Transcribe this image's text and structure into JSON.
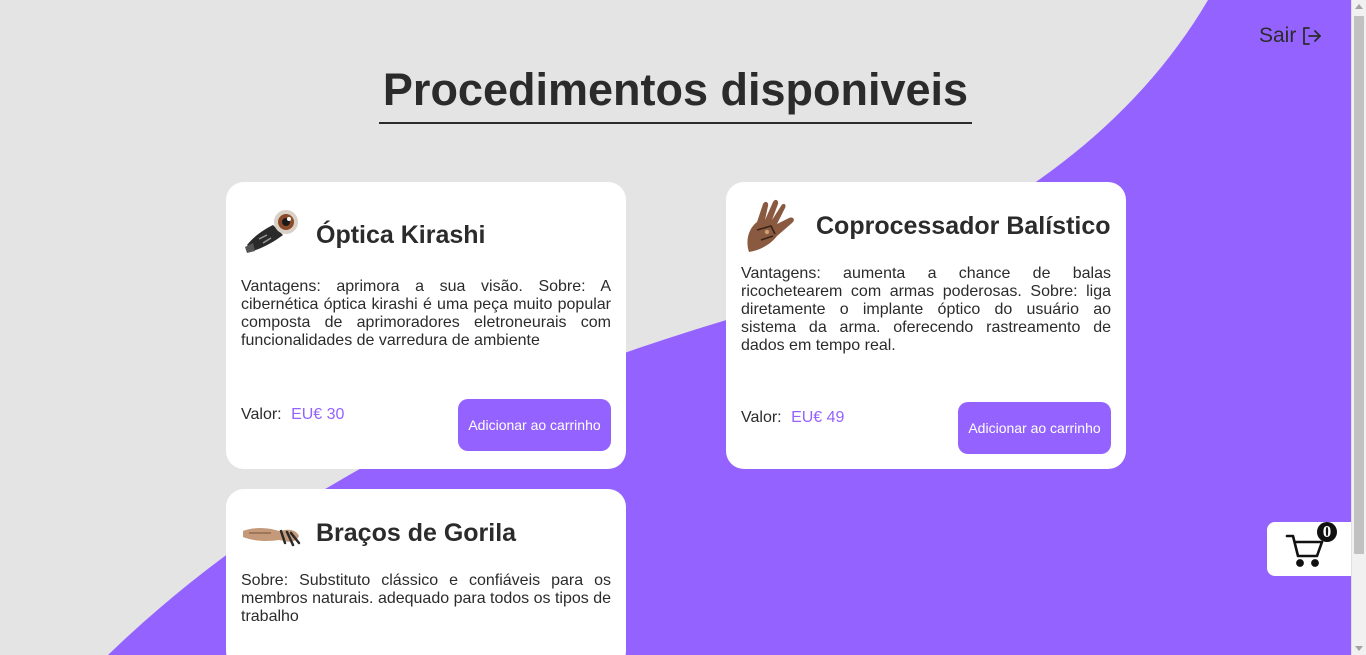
{
  "header": {
    "logout_label": "Sair",
    "logout_icon": "sign-out-icon",
    "title": "Procedimentos disponiveis"
  },
  "colors": {
    "accent": "#9463ff",
    "background": "#e4e4e4",
    "card": "#ffffff",
    "text": "#2b2b2b"
  },
  "products": [
    {
      "title": "Óptica Kirashi",
      "icon": "cybernetic-eye-icon",
      "description": "Vantagens: aprimora a sua visão. Sobre: A cibernética óptica kirashi é uma peça muito popular composta de aprimoradores eletroneurais com funcionalidades de varredura de ambiente",
      "price_label": "Valor:",
      "price": "EU€ 30",
      "button_label": "Adicionar ao carrinho"
    },
    {
      "title": "Coprocessador Balístico",
      "icon": "cybernetic-hand-icon",
      "description": "Vantagens: aumenta a chance de balas ricochetearem com armas poderosas. Sobre: liga diretamente o implante óptico do usuário ao sistema da arma. oferecendo rastreamento de dados em tempo real.",
      "price_label": "Valor:",
      "price": "EU€ 49",
      "button_label": "Adicionar ao carrinho"
    },
    {
      "title": "Braços de Gorila",
      "icon": "cybernetic-arm-icon",
      "description": "Sobre: Substituto clássico e confiáveis para os membros naturais. adequado para todos os tipos de trabalho"
    }
  ],
  "cart": {
    "icon": "shopping-cart-icon",
    "count": "0"
  }
}
